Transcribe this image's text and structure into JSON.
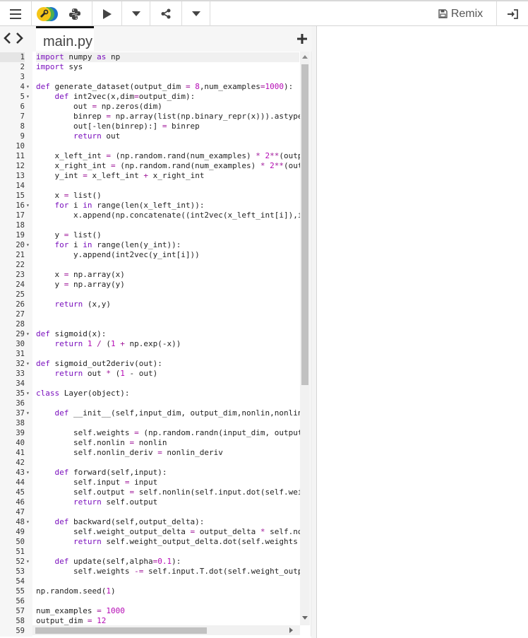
{
  "toolbar": {
    "menu_icon": "hamburger-icon",
    "run_icon": "play-icon",
    "share_icon": "share-icon",
    "remix_label": "Remix",
    "login_icon": "sign-in-icon"
  },
  "tabs": {
    "active_file": "main.py"
  },
  "code": [
    {
      "n": "1",
      "t": "import numpy as np"
    },
    {
      "n": "2",
      "t": "import sys"
    },
    {
      "n": "3",
      "t": ""
    },
    {
      "n": "4",
      "t": "def generate_dataset(output_dim = 8,num_examples=1000):",
      "f": true
    },
    {
      "n": "5",
      "t": "    def int2vec(x,dim=output_dim):",
      "f": true
    },
    {
      "n": "6",
      "t": "        out = np.zeros(dim)"
    },
    {
      "n": "7",
      "t": "        binrep = np.array(list(np.binary_repr(x))).astype"
    },
    {
      "n": "8",
      "t": "        out[-len(binrep):] = binrep"
    },
    {
      "n": "9",
      "t": "        return out"
    },
    {
      "n": "10",
      "t": ""
    },
    {
      "n": "11",
      "t": "    x_left_int = (np.random.rand(num_examples) * 2**(outp"
    },
    {
      "n": "12",
      "t": "    x_right_int = (np.random.rand(num_examples) * 2**(out"
    },
    {
      "n": "13",
      "t": "    y_int = x_left_int + x_right_int"
    },
    {
      "n": "14",
      "t": ""
    },
    {
      "n": "15",
      "t": "    x = list()"
    },
    {
      "n": "16",
      "t": "    for i in range(len(x_left_int)):",
      "f": true
    },
    {
      "n": "17",
      "t": "        x.append(np.concatenate((int2vec(x_left_int[i]),i"
    },
    {
      "n": "18",
      "t": ""
    },
    {
      "n": "19",
      "t": "    y = list()"
    },
    {
      "n": "20",
      "t": "    for i in range(len(y_int)):",
      "f": true
    },
    {
      "n": "21",
      "t": "        y.append(int2vec(y_int[i]))"
    },
    {
      "n": "22",
      "t": ""
    },
    {
      "n": "23",
      "t": "    x = np.array(x)"
    },
    {
      "n": "24",
      "t": "    y = np.array(y)"
    },
    {
      "n": "25",
      "t": ""
    },
    {
      "n": "26",
      "t": "    return (x,y)"
    },
    {
      "n": "27",
      "t": ""
    },
    {
      "n": "28",
      "t": ""
    },
    {
      "n": "29",
      "t": "def sigmoid(x):",
      "f": true
    },
    {
      "n": "30",
      "t": "    return 1 / (1 + np.exp(-x))"
    },
    {
      "n": "31",
      "t": ""
    },
    {
      "n": "32",
      "t": "def sigmoid_out2deriv(out):",
      "f": true
    },
    {
      "n": "33",
      "t": "    return out * (1 - out)"
    },
    {
      "n": "34",
      "t": ""
    },
    {
      "n": "35",
      "t": "class Layer(object):",
      "f": true
    },
    {
      "n": "36",
      "t": ""
    },
    {
      "n": "37",
      "t": "    def __init__(self,input_dim, output_dim,nonlin,nonlin",
      "f": true
    },
    {
      "n": "38",
      "t": ""
    },
    {
      "n": "39",
      "t": "        self.weights = (np.random.randn(input_dim, output"
    },
    {
      "n": "40",
      "t": "        self.nonlin = nonlin"
    },
    {
      "n": "41",
      "t": "        self.nonlin_deriv = nonlin_deriv"
    },
    {
      "n": "42",
      "t": ""
    },
    {
      "n": "43",
      "t": "    def forward(self,input):",
      "f": true
    },
    {
      "n": "44",
      "t": "        self.input = input"
    },
    {
      "n": "45",
      "t": "        self.output = self.nonlin(self.input.dot(self.wei"
    },
    {
      "n": "46",
      "t": "        return self.output"
    },
    {
      "n": "47",
      "t": ""
    },
    {
      "n": "48",
      "t": "    def backward(self,output_delta):",
      "f": true
    },
    {
      "n": "49",
      "t": "        self.weight_output_delta = output_delta * self.no"
    },
    {
      "n": "50",
      "t": "        return self.weight_output_delta.dot(self.weights"
    },
    {
      "n": "51",
      "t": ""
    },
    {
      "n": "52",
      "t": "    def update(self,alpha=0.1):",
      "f": true
    },
    {
      "n": "53",
      "t": "        self.weights -= self.input.T.dot(self.weight_outp"
    },
    {
      "n": "54",
      "t": ""
    },
    {
      "n": "55",
      "t": "np.random.seed(1)"
    },
    {
      "n": "56",
      "t": ""
    },
    {
      "n": "57",
      "t": "num_examples = 1000"
    },
    {
      "n": "58",
      "t": "output_dim = 12"
    },
    {
      "n": "59",
      "t": ""
    }
  ]
}
